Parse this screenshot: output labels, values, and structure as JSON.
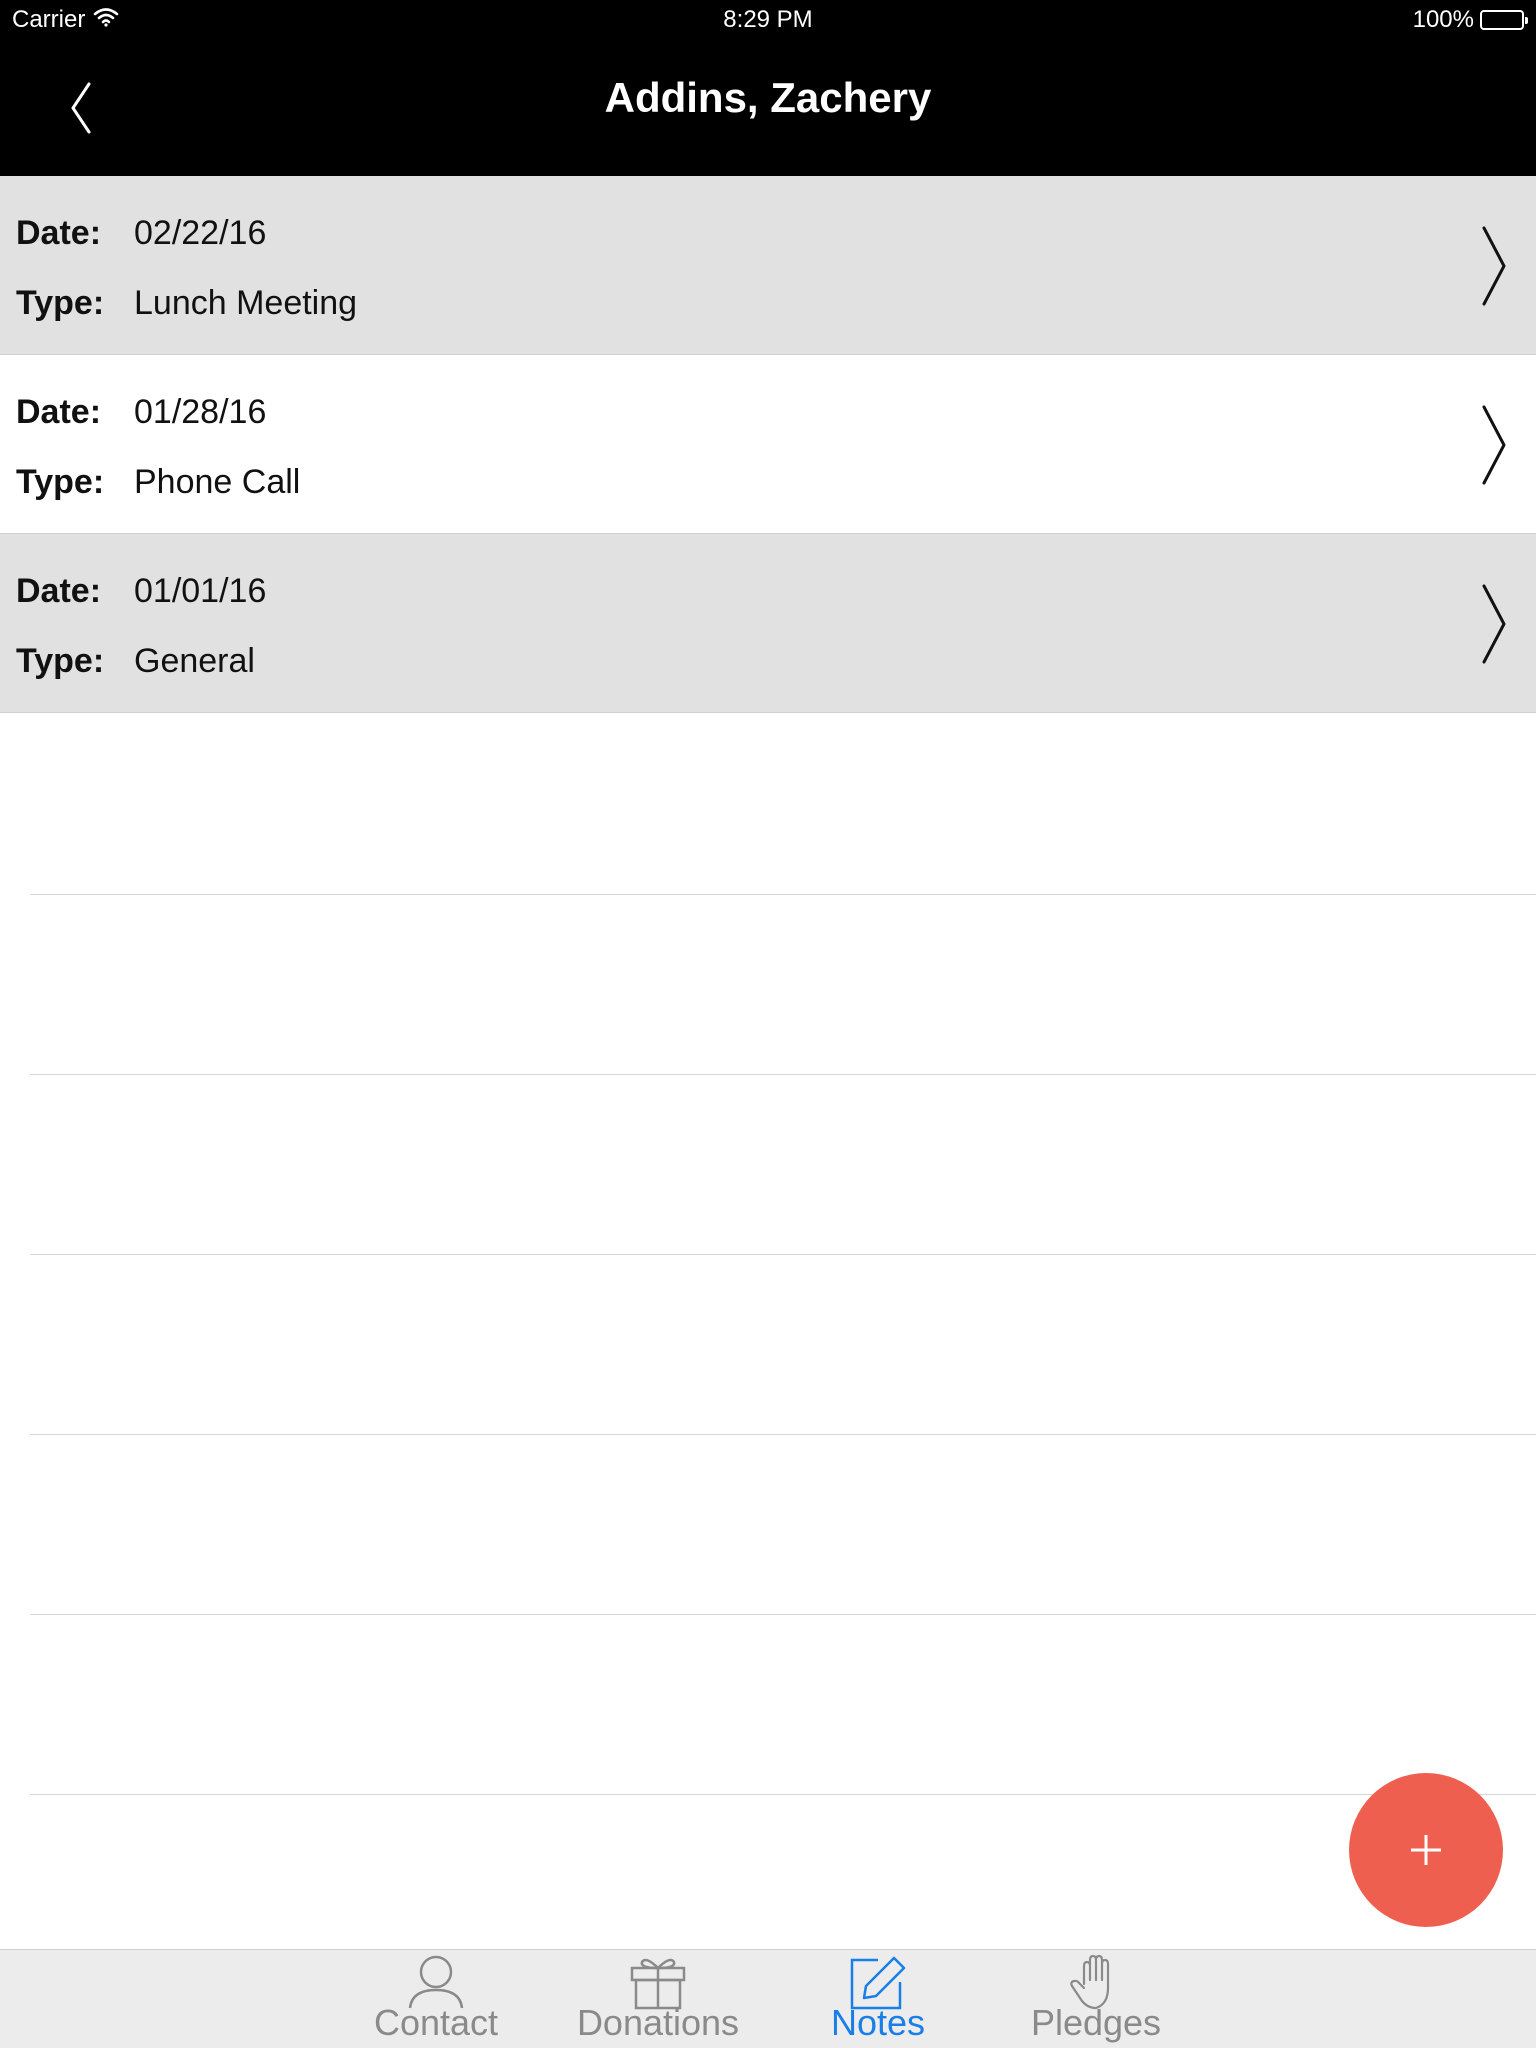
{
  "status_bar": {
    "carrier": "Carrier",
    "time": "8:29 PM",
    "battery": "100%"
  },
  "nav": {
    "title": "Addins, Zachery",
    "back_icon": "chevron-left-icon"
  },
  "notes": {
    "date_label": "Date:",
    "type_label": "Type:",
    "items": [
      {
        "date": "02/22/16",
        "type": "Lunch Meeting"
      },
      {
        "date": "01/28/16",
        "type": "Phone Call"
      },
      {
        "date": "01/01/16",
        "type": "General"
      }
    ]
  },
  "fab": {
    "icon": "plus-icon",
    "color": "#ef5f50"
  },
  "tabs": [
    {
      "label": "Contact",
      "icon": "person-icon",
      "active": false
    },
    {
      "label": "Donations",
      "icon": "gift-icon",
      "active": false
    },
    {
      "label": "Notes",
      "icon": "edit-note-icon",
      "active": true
    },
    {
      "label": "Pledges",
      "icon": "hand-icon",
      "active": false
    }
  ],
  "colors": {
    "accent": "#1a7ee8",
    "row_shaded": "#e1e1e1",
    "header": "#000000"
  }
}
